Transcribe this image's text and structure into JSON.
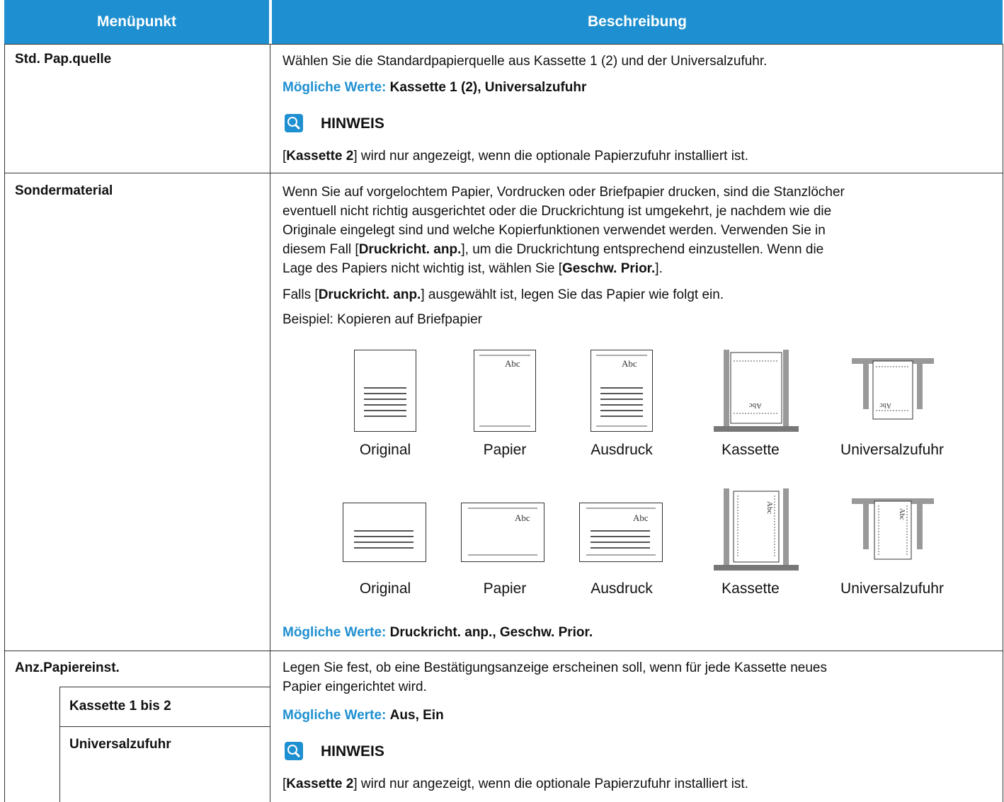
{
  "table": {
    "headers": {
      "menu": "Menüpunkt",
      "description": "Beschreibung"
    }
  },
  "rows": {
    "std_pap_quelle": {
      "label": "Std. Pap.quelle",
      "desc": "Wählen Sie die Standardpapierquelle aus Kassette 1 (2) und der Universalzufuhr.",
      "values_label": "Mögliche Werte:",
      "values": "Kassette 1 (2), Universalzufuhr",
      "note_title": "HINWEIS",
      "note_bold": "Kassette 2",
      "note_rest": "] wird nur angezeigt, wenn die optionale Papierzufuhr installiert ist."
    },
    "sondermaterial": {
      "label": "Sondermaterial",
      "p1_l1": "Wenn Sie auf vorgelochtem Papier, Vordrucken oder Briefpapier drucken, sind die Stanzlöcher",
      "p1_l2": "eventuell nicht richtig ausgerichtet oder die Druckrichtung ist umgekehrt, je nachdem wie die",
      "p1_l3": "Originale eingelegt sind und welche Kopierfunktionen verwendet werden. Verwenden Sie in",
      "p1_l4a": "diesem Fall [",
      "p1_l4b": "Druckricht. anp.",
      "p1_l4c": "], um die Druckrichtung entsprechend einzustellen. Wenn die",
      "p1_l5a": "Lage des Papiers nicht wichtig ist, wählen Sie [",
      "p1_l5b": "Geschw. Prior.",
      "p1_l5c": "].",
      "p2a": "Falls [",
      "p2b": "Druckricht. anp.",
      "p2c": "] ausgewählt ist, legen Sie das Papier wie folgt ein.",
      "p3": "Beispiel: Kopieren auf Briefpapier",
      "captions": [
        "Original",
        "Papier",
        "Ausdruck",
        "Kassette",
        "Universalzufuhr"
      ],
      "abc": "Abc",
      "values_label": "Mögliche Werte:",
      "values": "Druckricht. anp., Geschw. Prior."
    },
    "anz_papiereinst": {
      "label": "Anz.Papiereinst.",
      "sub1": "Kassette 1 bis 2",
      "sub2": "Universalzufuhr",
      "desc_l1": "Legen Sie fest, ob eine Bestätigungsanzeige erscheinen soll, wenn für jede Kassette neues",
      "desc_l2": "Papier eingerichtet wird.",
      "values_label": "Mögliche Werte:",
      "values": "Aus, Ein",
      "note_title": "HINWEIS",
      "note_bold": "Kassette 2",
      "note_rest": "] wird nur angezeigt, wenn die optionale Papierzufuhr installiert ist."
    }
  }
}
